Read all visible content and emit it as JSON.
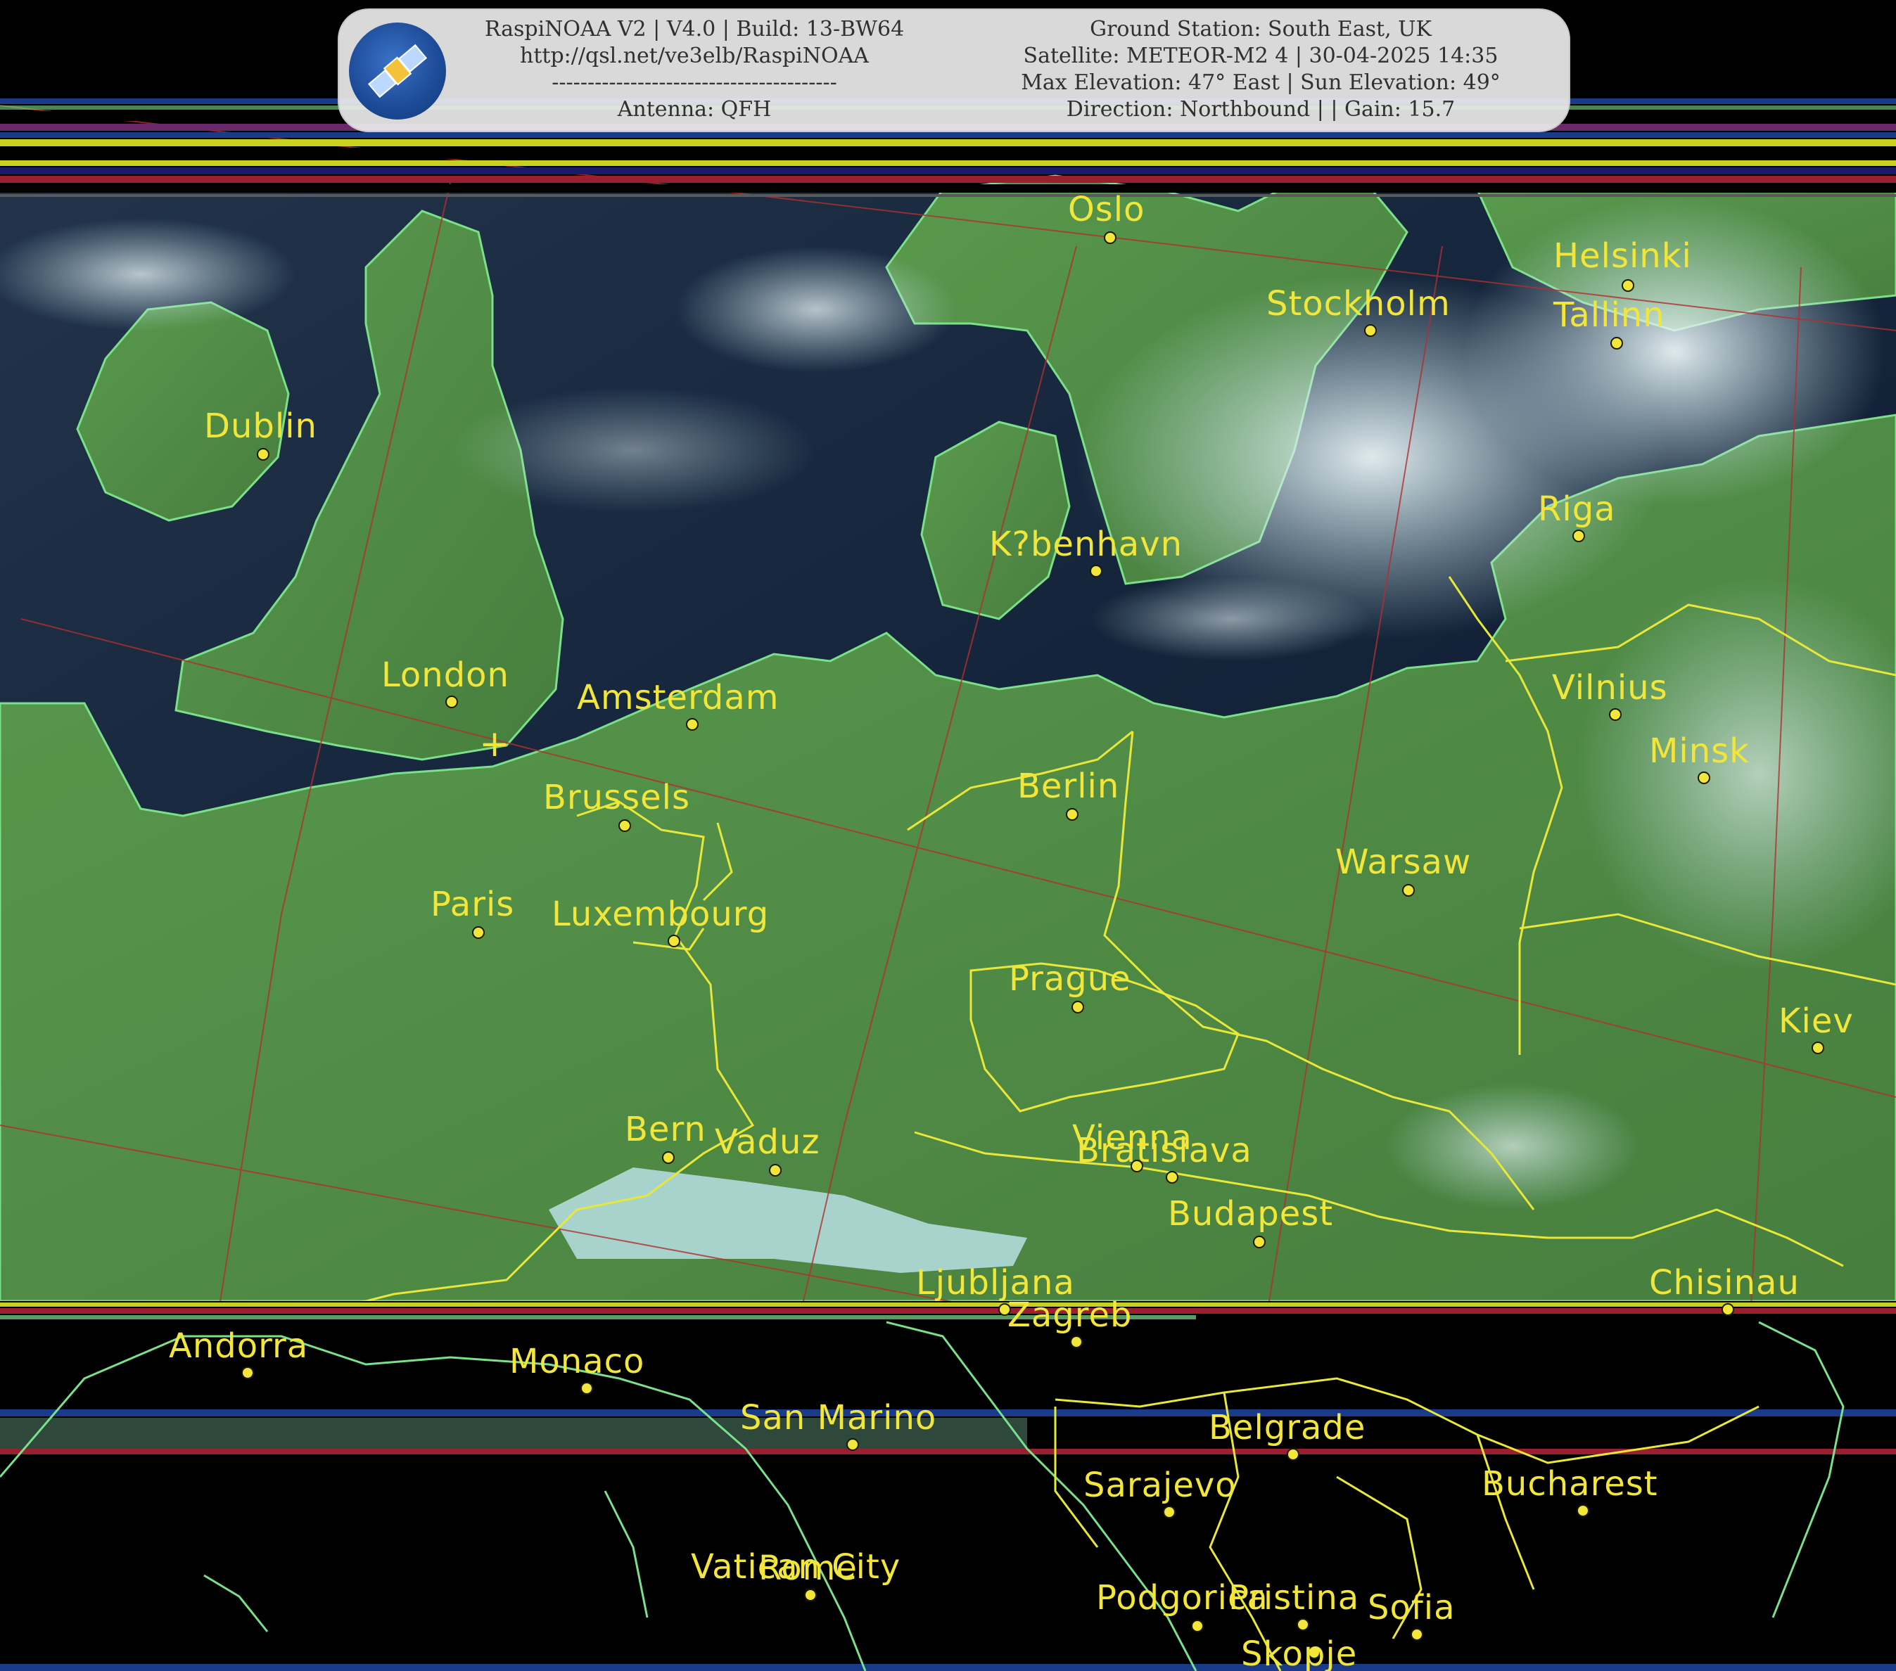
{
  "banner": {
    "left_lines": [
      "RaspiNOAA V2 | V4.0 | Build: 13-BW64",
      "http://qsl.net/ve3elb/RaspiNOAA",
      "----------------------------------------",
      "Antenna: QFH"
    ],
    "right_lines": [
      "Ground Station: South East, UK",
      "Satellite: METEOR-M2 4 | 30-04-2025 14:35",
      "Max Elevation: 47° East | Sun Elevation: 49°",
      "Direction: Northbound | | Gain: 15.7"
    ],
    "logo_icon": "satellite-icon"
  },
  "colors": {
    "city_label": "#f2e63a",
    "coastline": "#7be08a",
    "border": "#e8e83a",
    "graticule": "#b03030",
    "sea": "#14243a",
    "land": "#4f8a45",
    "cloud": "#d8e8ec",
    "background": "#000000"
  },
  "ground_station_marker": "+",
  "cities": [
    {
      "name": "Oslo"
    },
    {
      "name": "Stockholm"
    },
    {
      "name": "Helsinki"
    },
    {
      "name": "Tallinn"
    },
    {
      "name": "Dublin"
    },
    {
      "name": "Riga"
    },
    {
      "name": "K?benhavn"
    },
    {
      "name": "London"
    },
    {
      "name": "Amsterdam"
    },
    {
      "name": "Vilnius"
    },
    {
      "name": "Minsk"
    },
    {
      "name": "Brussels"
    },
    {
      "name": "Berlin"
    },
    {
      "name": "Warsaw"
    },
    {
      "name": "Paris"
    },
    {
      "name": "Luxembourg"
    },
    {
      "name": "Prague"
    },
    {
      "name": "Kiev"
    },
    {
      "name": "Bern"
    },
    {
      "name": "Vaduz"
    },
    {
      "name": "Vienna"
    },
    {
      "name": "Bratislava"
    },
    {
      "name": "Budapest"
    },
    {
      "name": "Ljubljana"
    },
    {
      "name": "Zagreb"
    },
    {
      "name": "Chisinau"
    },
    {
      "name": "Andorra"
    },
    {
      "name": "Monaco"
    },
    {
      "name": "San Marino"
    },
    {
      "name": "Belgrade"
    },
    {
      "name": "Sarajevo"
    },
    {
      "name": "Bucharest"
    },
    {
      "name": "Vatican City"
    },
    {
      "name": "Rome"
    },
    {
      "name": "Podgorica"
    },
    {
      "name": "Pristina"
    },
    {
      "name": "Sofia"
    },
    {
      "name": "Skopje"
    }
  ]
}
